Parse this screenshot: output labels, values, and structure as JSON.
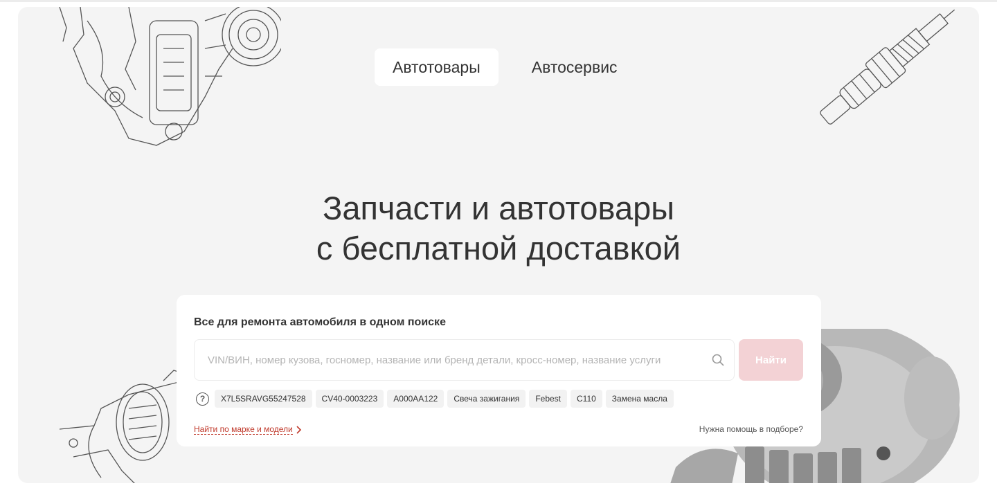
{
  "tabs": [
    {
      "label": "Автотовары",
      "active": true
    },
    {
      "label": "Автосервис",
      "active": false
    }
  ],
  "headline": {
    "line1": "Запчасти и автотовары",
    "line2": "с бесплатной доставкой"
  },
  "search": {
    "title": "Все для ремонта автомобиля в одном поиске",
    "placeholder": "VIN/ВИН, номер кузова, госномер, название или бренд детали, кросс-номер, название услуги",
    "value": "",
    "button_label": "Найти",
    "button_color": "#f3d2d5",
    "help_symbol": "?",
    "examples": [
      "X7L5SRAVG55247528",
      "CV40-0003223",
      "А000АА122",
      "Свеча зажигания",
      "Febest",
      "C110",
      "Замена масла"
    ],
    "brand_link": "Найти по марке и модели",
    "help_link": "Нужна помощь в подборе?"
  },
  "colors": {
    "accent": "#c0392b",
    "hero_bg": "#f4f4f4",
    "text": "#333333"
  },
  "icons": {
    "search": "search-icon",
    "question": "question-circle-icon",
    "chevron": "chevron-right-icon"
  }
}
